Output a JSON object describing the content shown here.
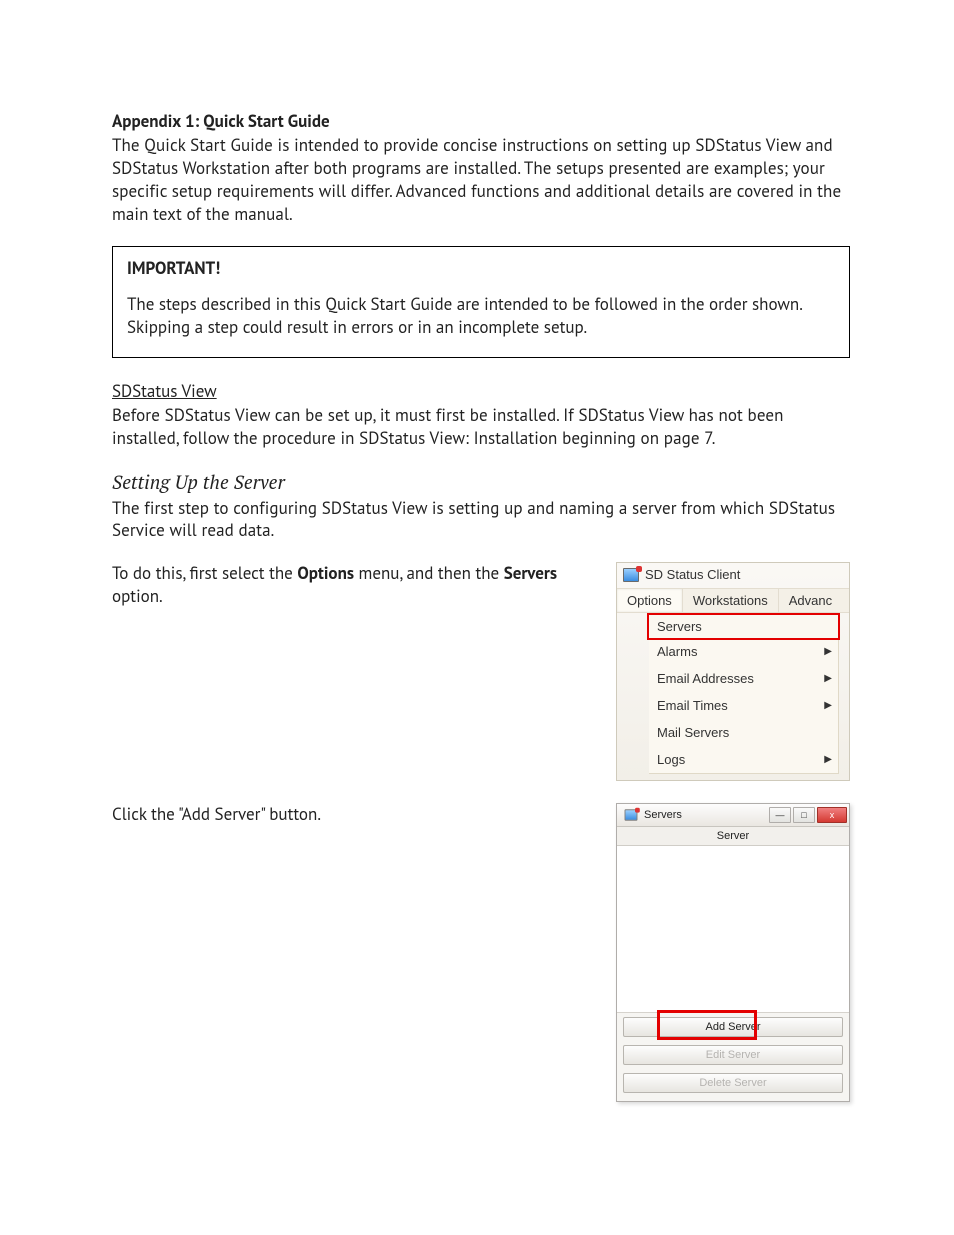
{
  "doc": {
    "heading1": "Appendix 1: Quick Start Guide",
    "intro": "The Quick Start Guide is intended to provide concise instructions on setting up SDStatus View and SDStatus Workstation after both programs are installed. The setups presented are examples; your specific setup requirements will differ. Advanced functions and additional details are covered in the main text of the manual.",
    "important_title": "IMPORTANT!",
    "important_text": "The steps described in this Quick Start Guide are intended to be followed in the order shown. Skipping a step could result in errors or in an incomplete setup.",
    "sdview_heading": "SDStatus View",
    "sdview_para": "Before SDStatus View can be set up, it must first be installed. If SDStatus View has not been installed, follow the procedure in SDStatus View: Installation beginning on page 7.",
    "setting_up_heading": "Setting Up the Server",
    "setting_up_para": "The first step to configuring SDStatus View is setting up and naming a server from which SDStatus Service will read data.",
    "step1_pre": "To do this, first select the ",
    "step1_bold1": "Options",
    "step1_mid": " menu, and then the ",
    "step1_bold2": "Servers",
    "step1_post": " option.",
    "step2": "Click the \"Add Server\" button."
  },
  "menu": {
    "window_title": "SD Status Client",
    "menubar": [
      "Options",
      "Workstations",
      "Advanc"
    ],
    "items": [
      {
        "label": "Servers",
        "submenu": false,
        "highlight": true
      },
      {
        "label": "Alarms",
        "submenu": true,
        "highlight": false
      },
      {
        "label": "Email Addresses",
        "submenu": true,
        "highlight": false
      },
      {
        "label": "Email Times",
        "submenu": true,
        "highlight": false
      },
      {
        "label": "Mail Servers",
        "submenu": false,
        "highlight": false
      },
      {
        "label": "Logs",
        "submenu": true,
        "highlight": false
      }
    ]
  },
  "servers_dialog": {
    "title": "Servers",
    "column": "Server",
    "buttons": {
      "add": "Add Server",
      "edit": "Edit Server",
      "delete": "Delete Server"
    },
    "window_controls": {
      "min": "—",
      "max": "□",
      "close": "x"
    }
  }
}
